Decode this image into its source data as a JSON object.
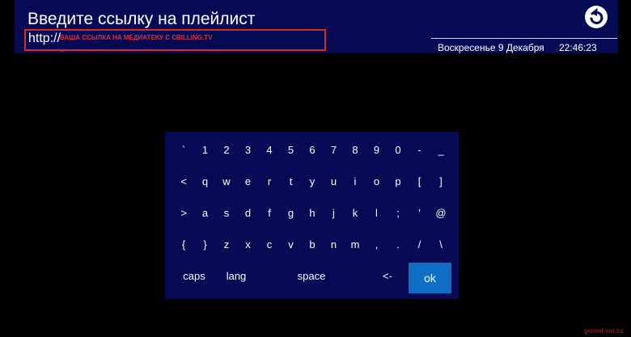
{
  "header": {
    "title": "Введите ссылку на плейлист",
    "url_prefix": "http://",
    "url_hint": "ВАША ССЫЛКА НА МЕДИАТЕКУ С CBILLING.TV",
    "date": "Воскресенье 9 Декабря",
    "time": "22:46:23",
    "back_icon": "back-arrow-icon"
  },
  "keyboard": {
    "rows": [
      [
        "`",
        "1",
        "2",
        "3",
        "4",
        "5",
        "6",
        "7",
        "8",
        "9",
        "0",
        "-",
        "_"
      ],
      [
        "<",
        "q",
        "w",
        "e",
        "r",
        "t",
        "y",
        "u",
        "i",
        "o",
        "p",
        "[",
        "]"
      ],
      [
        ">",
        "a",
        "s",
        "d",
        "f",
        "g",
        "h",
        "j",
        "k",
        "l",
        ";",
        "'",
        "@"
      ],
      [
        "{",
        "}",
        "z",
        "x",
        "c",
        "v",
        "b",
        "n",
        "m",
        ",",
        ".",
        "/",
        "\\"
      ]
    ],
    "bottom": {
      "caps": "caps",
      "lang": "lang",
      "space": "space",
      "backspace": "<-",
      "ok": "ok"
    },
    "accent_color": "#0f6ec4"
  },
  "watermark": "gomel-sat.bz"
}
